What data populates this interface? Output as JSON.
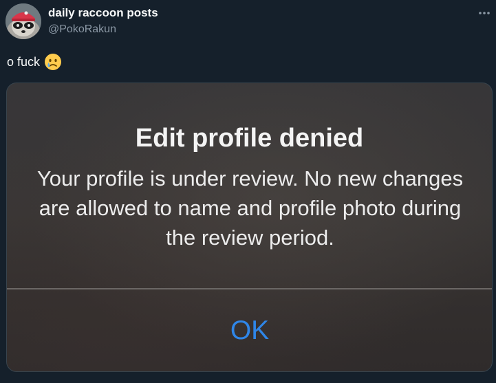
{
  "tweet": {
    "author": {
      "display_name": "daily raccoon posts",
      "handle": "@PokoRakun",
      "avatar_icon": "raccoon-avatar"
    },
    "more_icon": "more-horizontal-icon",
    "text": "o fuck",
    "emoji_icon": "crying-face-icon",
    "colors": {
      "background": "#15202b",
      "text_primary": "#f7f9f9",
      "text_secondary": "#8b98a5"
    }
  },
  "media": {
    "alert": {
      "title": "Edit profile denied",
      "message": "Your profile is under review. No new changes are allowed to name and profile photo during the review period.",
      "ok_label": "OK",
      "accent_color": "#2f86e8"
    }
  }
}
